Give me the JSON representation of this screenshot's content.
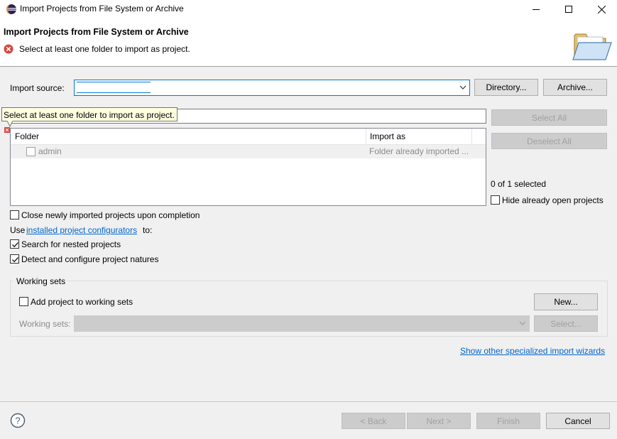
{
  "window": {
    "title": "Import Projects from File System or Archive"
  },
  "header": {
    "title": "Import Projects from File System or Archive",
    "message": "Select at least one folder to import as project."
  },
  "import_source": {
    "label": "Import source:",
    "value": "",
    "directory_button": "Directory...",
    "archive_button": "Archive..."
  },
  "tooltip": {
    "text": "Select at least one folder to import as project."
  },
  "selection_buttons": {
    "select_all": "Select All",
    "deselect_all": "Deselect All"
  },
  "table": {
    "columns": [
      "Folder",
      "Import as"
    ],
    "rows": [
      {
        "folder": "admin",
        "import_as": "Folder already imported ...",
        "checked": false
      }
    ]
  },
  "selection": {
    "count_text": "0 of 1 selected",
    "hide_open_label": "Hide already open projects",
    "hide_open_checked": false
  },
  "options": {
    "close_newly_label": "Close newly imported projects upon completion",
    "close_newly_checked": false,
    "use_prefix": "Use",
    "configurators_link": "installed project configurators",
    "use_suffix": "to:",
    "nested_label": "Search for nested projects",
    "nested_checked": true,
    "natures_label": "Detect and configure project natures",
    "natures_checked": true
  },
  "working_sets": {
    "group_title": "Working sets",
    "add_label": "Add project to working sets",
    "add_checked": false,
    "new_button": "New...",
    "sets_label": "Working sets:",
    "select_button": "Select..."
  },
  "links": {
    "other_wizards": "Show other specialized import wizards"
  },
  "footer": {
    "back": "< Back",
    "next": "Next >",
    "finish": "Finish",
    "cancel": "Cancel"
  }
}
